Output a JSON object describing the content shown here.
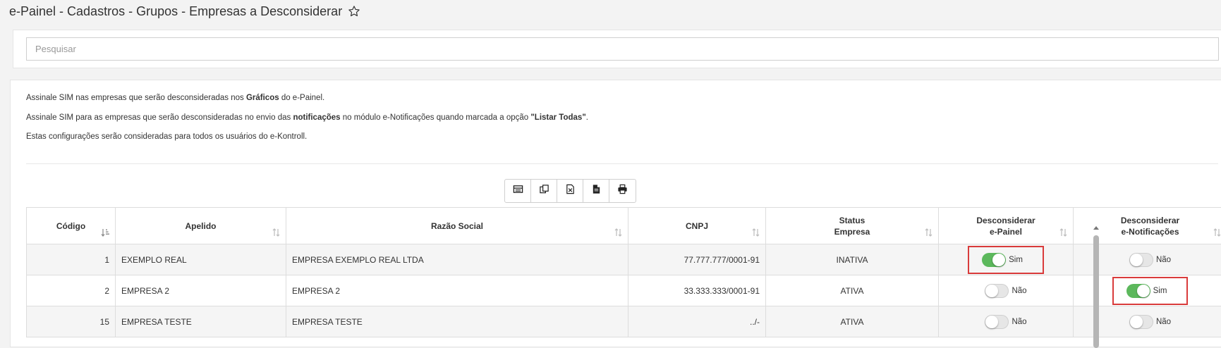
{
  "page": {
    "title": "e-Painel - Cadastros - Grupos - Empresas a Desconsiderar"
  },
  "search": {
    "placeholder": "Pesquisar",
    "value": ""
  },
  "instructions": {
    "line1_a": "Assinale SIM nas empresas que serão desconsideradas nos ",
    "line1_b": "Gráficos",
    "line1_c": " do e-Painel.",
    "line2_a": "Assinale SIM para as empresas que serão desconsideradas no envio das ",
    "line2_b": "notificações",
    "line2_c": " no módulo e-Notificações quando marcada a opção ",
    "line2_d": "\"Listar Todas\"",
    "line2_e": ".",
    "line3": "Estas configurações serão consideradas para todos os usuários do e-Kontroll."
  },
  "toolbar": {
    "buttons": [
      {
        "name": "columns-icon"
      },
      {
        "name": "copy-icon"
      },
      {
        "name": "excel-icon"
      },
      {
        "name": "csv-icon"
      },
      {
        "name": "print-icon"
      }
    ]
  },
  "table": {
    "headers": {
      "codigo": "Código",
      "apelido": "Apelido",
      "razao_social": "Razão Social",
      "cnpj": "CNPJ",
      "status_l1": "Status",
      "status_l2": "Empresa",
      "desc_painel_l1": "Desconsiderar",
      "desc_painel_l2": "e-Painel",
      "desc_notif_l1": "Desconsiderar",
      "desc_notif_l2": "e-Notificações"
    },
    "rows": [
      {
        "codigo": "1",
        "apelido": "EXEMPLO REAL",
        "razao_social": "EMPRESA EXEMPLO REAL LTDA",
        "cnpj": "77.777.777/0001-91",
        "status": "INATIVA",
        "painel_on": true,
        "painel_label": "Sim",
        "painel_highlight": true,
        "notif_on": false,
        "notif_label": "Não",
        "notif_highlight": false
      },
      {
        "codigo": "2",
        "apelido": "EMPRESA 2",
        "razao_social": "EMPRESA 2",
        "cnpj": "33.333.333/0001-91",
        "status": "ATIVA",
        "painel_on": false,
        "painel_label": "Não",
        "painel_highlight": false,
        "notif_on": true,
        "notif_label": "Sim",
        "notif_highlight": true
      },
      {
        "codigo": "15",
        "apelido": "EMPRESA TESTE",
        "razao_social": "EMPRESA TESTE",
        "cnpj": "../-",
        "status": "ATIVA",
        "painel_on": false,
        "painel_label": "Não",
        "painel_highlight": false,
        "notif_on": false,
        "notif_label": "Não",
        "notif_highlight": false
      }
    ]
  },
  "colors": {
    "toggle_on": "#5cb85c",
    "highlight_border": "#d93b3b"
  }
}
